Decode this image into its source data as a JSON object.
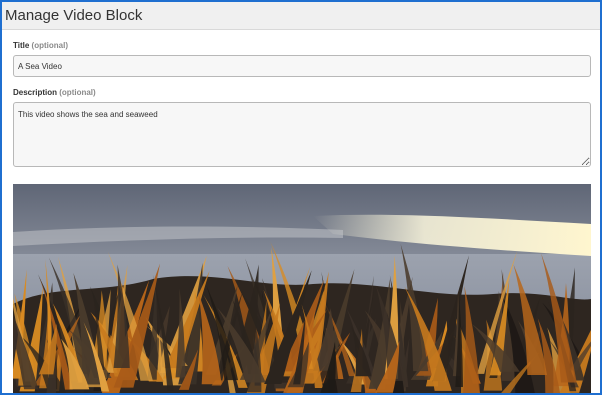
{
  "header": {
    "title": "Manage Video Block"
  },
  "form": {
    "title_label": "Title",
    "title_optional": "(optional)",
    "title_value": "A Sea Video",
    "description_label": "Description",
    "description_optional": "(optional)",
    "description_value": "This video shows the sea and seaweed"
  },
  "video": {
    "subject": "sea and seaweed",
    "colors": {
      "sky": "#6f7685",
      "water": "#a3a8b4",
      "glare": "#f4f0d8",
      "seaweed_dark": "#2c2620",
      "seaweed_orange": "#c77a1e"
    }
  },
  "colors": {
    "frame_border": "#1f6fd0",
    "header_bg": "#f0f0f0"
  }
}
